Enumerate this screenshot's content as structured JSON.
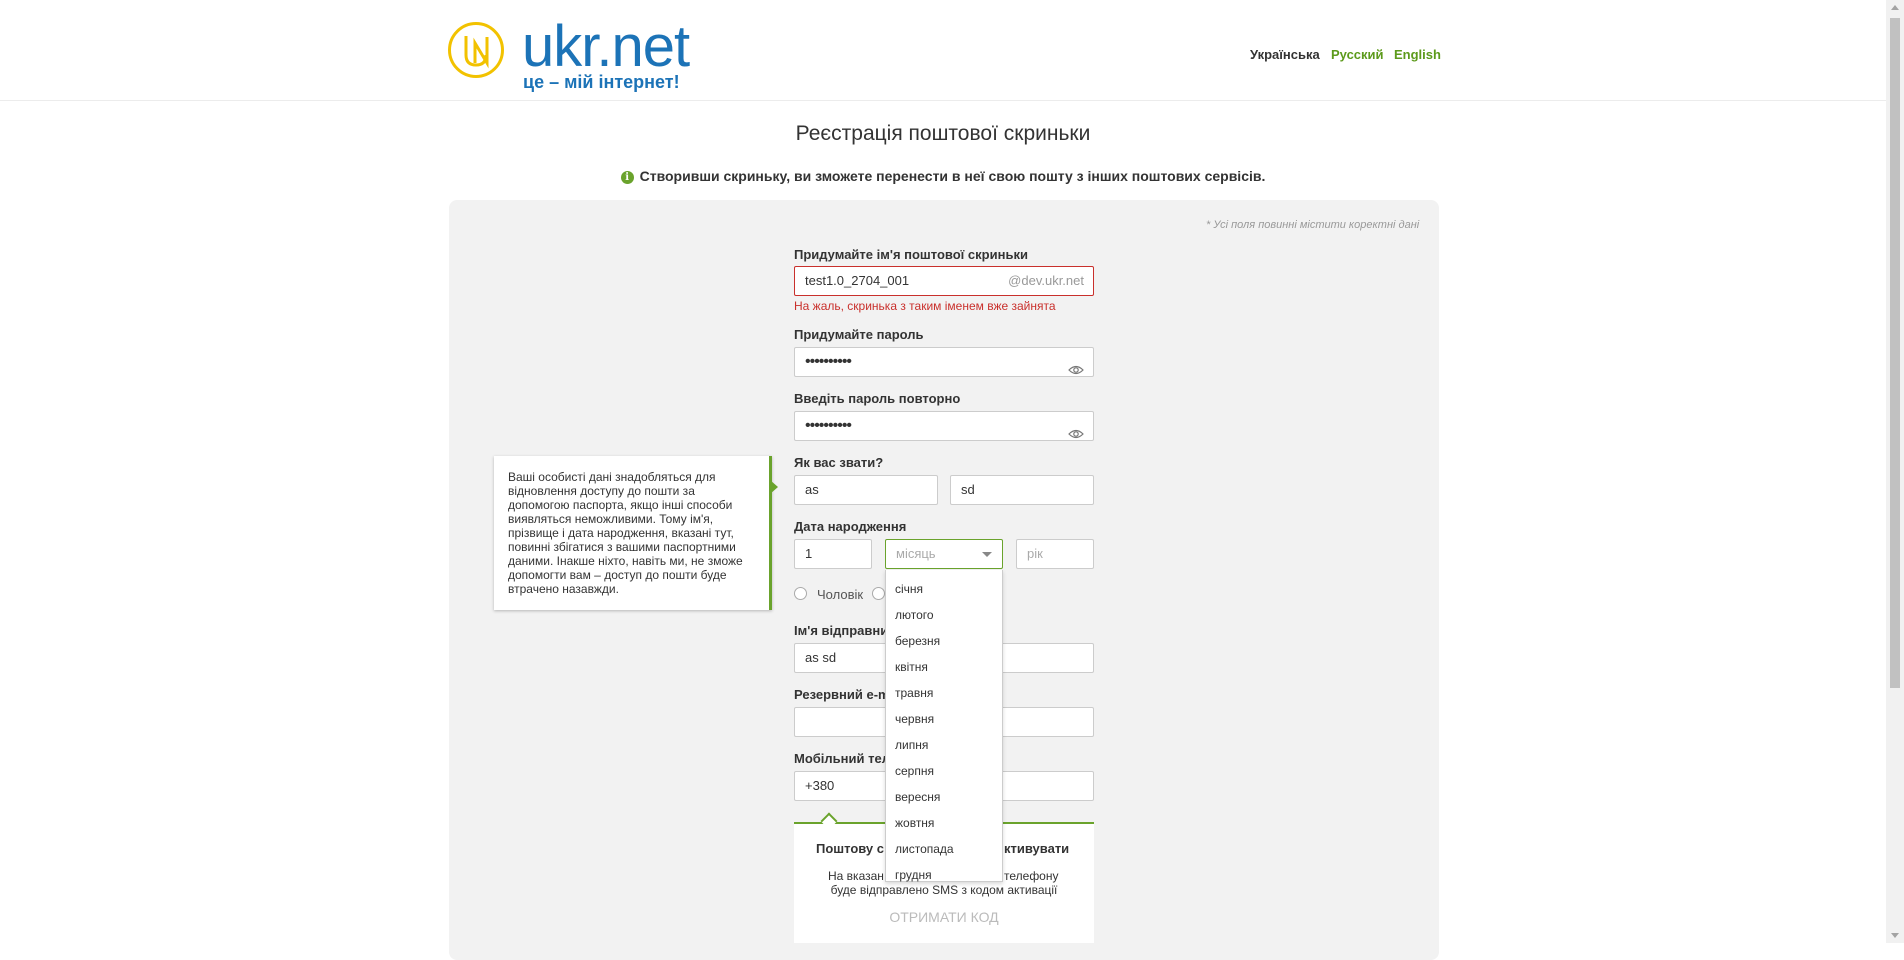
{
  "header": {
    "logo_text": "ukr.net",
    "logo_slogan": "це – мій інтернет!",
    "languages": [
      "Українська",
      "Русский",
      "English"
    ]
  },
  "page": {
    "title": "Реєстрація поштової скриньки",
    "info": "Створивши скриньку, ви зможете перенести в неї свою пошту з інших поштових сервісів.",
    "required_note": "* Усі поля повинні містити коректні дані"
  },
  "form": {
    "mailbox": {
      "label": "Придумайте ім'я поштової скриньки",
      "value": "test1.0_2704_001",
      "suffix": "@dev.ukr.net",
      "error": "На жаль, скринька з таким іменем вже зайнята"
    },
    "password": {
      "label": "Придумайте пароль",
      "value": "••••••••••"
    },
    "password_repeat": {
      "label": "Введіть пароль повторно",
      "value": "••••••••••"
    },
    "name": {
      "label": "Як вас звати?",
      "first": "as",
      "last": "sd"
    },
    "birthdate": {
      "label": "Дата народження",
      "day": "1",
      "month_placeholder": "місяць",
      "year_placeholder": "рік"
    },
    "gender": {
      "male": "Чоловік"
    },
    "sender_name": {
      "label": "Ім'я відправник",
      "value": "as sd"
    },
    "backup_email": {
      "label": "Резервний e-ma",
      "value": ""
    },
    "phone": {
      "label": "Мобільний теле",
      "value": "+380"
    },
    "sms": {
      "title_left": "Поштову с",
      "title_right": "ктивувати",
      "text1_left": "На вказан",
      "text1_right": "телефону",
      "text2": "буде відправлено SMS з кодом активації",
      "button": "ОТРИМАТИ КОД"
    }
  },
  "tooltip": {
    "text": "Ваші особисті дані знадобляться для відновлення доступу до пошти за допомогою паспорта, якщо інші способи виявляться неможливими. Тому ім'я, прізвище і дата народження, вказані тут, повинні збігатися з вашими паспортними даними. Інакше ніхто, навіть ми, не зможе допомогти вам – доступ до пошти буде втрачено назавжди."
  },
  "months": [
    "січня",
    "лютого",
    "березня",
    "квітня",
    "травня",
    "червня",
    "липня",
    "серпня",
    "вересня",
    "жовтня",
    "листопада",
    "грудня"
  ],
  "colors": {
    "accent_green": "#6aa32c",
    "link_green": "#5c9a1b",
    "brand_blue": "#1c73b7",
    "logo_yellow": "#f2c200",
    "error_red": "#c9302c",
    "panel_bg": "#f2f2f2"
  }
}
